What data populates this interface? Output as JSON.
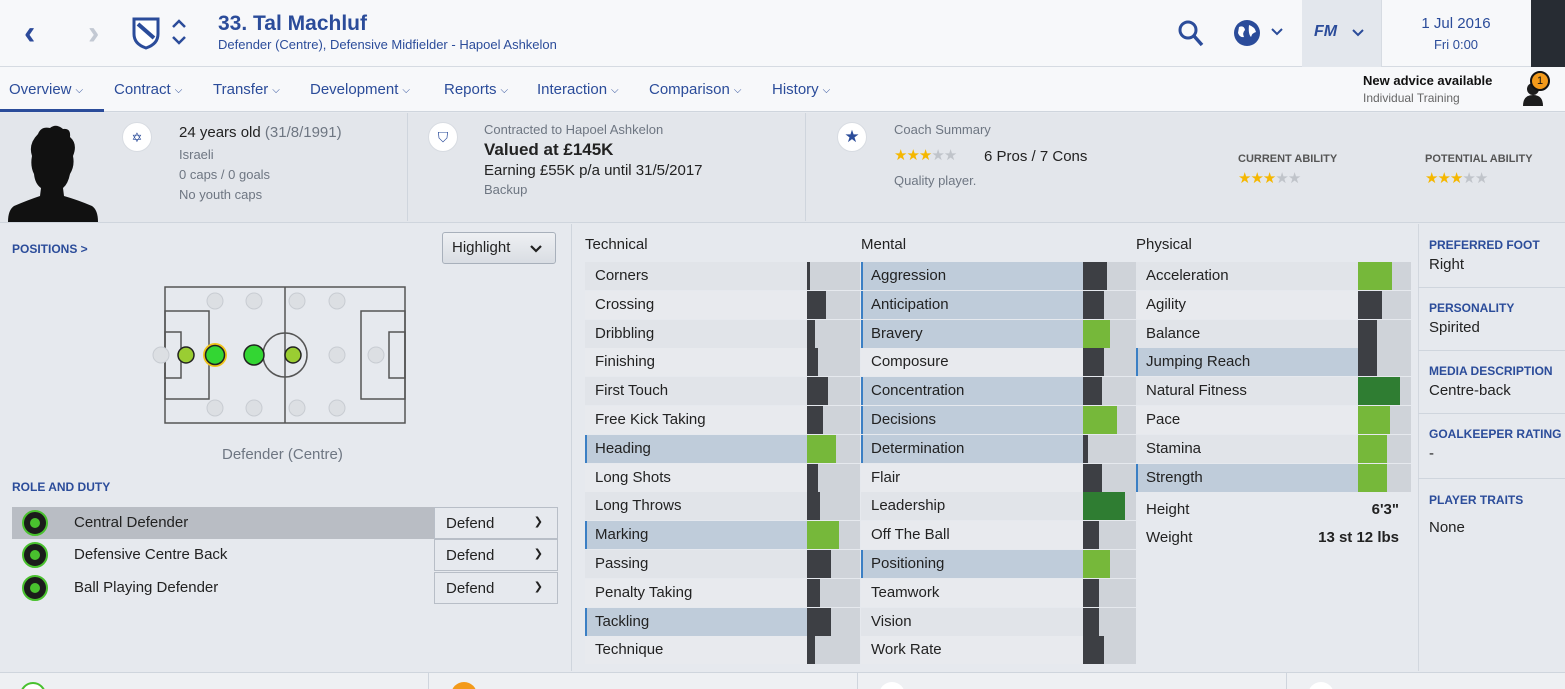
{
  "header": {
    "player_title": "33. Tal Machluf",
    "player_subtitle": "Defender (Centre), Defensive Midfielder - Hapoel Ashkelon",
    "back_glyph": "‹",
    "forward_glyph": "›",
    "fm_logo": "FM",
    "date": "1 Jul 2016",
    "time": "Fri 0:00",
    "icons": [
      "back-arrow-icon",
      "forward-arrow-icon",
      "club-badge-icon",
      "up-down-chevron-icon",
      "search-icon",
      "globe-icon",
      "fm-menu-icon"
    ]
  },
  "tabs": [
    {
      "label": "Overview"
    },
    {
      "label": "Contract"
    },
    {
      "label": "Transfer"
    },
    {
      "label": "Development"
    },
    {
      "label": "Reports"
    },
    {
      "label": "Interaction"
    },
    {
      "label": "Comparison"
    },
    {
      "label": "History"
    }
  ],
  "advice": {
    "title": "New advice available",
    "subtitle": "Individual Training",
    "count": "1"
  },
  "personal": {
    "age": "24 years old",
    "dob": "(31/8/1991)",
    "nationality": "Israeli",
    "caps": "0 caps / 0 goals",
    "youth_caps": "No youth caps",
    "flag_glyph": "✡"
  },
  "contract": {
    "club": "Contracted to Hapoel Ashkelon",
    "value": "Valued at £145K",
    "earning": "Earning £55K p/a until 31/5/2017",
    "status": "Backup",
    "badge_glyph": "⛉"
  },
  "coach": {
    "title": "Coach Summary",
    "rating": 3,
    "pros_cons": "6 Pros / 7 Cons",
    "quality": "Quality player.",
    "current_ability_label": "CURRENT ABILITY",
    "current_ability_stars": 3,
    "potential_ability_label": "POTENTIAL ABILITY",
    "potential_ability_stars": 3,
    "star_glyph": "★"
  },
  "positions": {
    "heading": "POSITIONS >",
    "highlight_label": "Highlight",
    "position_label": "Defender (Centre)"
  },
  "role_duty": {
    "heading": "ROLE AND DUTY",
    "roles": [
      {
        "name": "Central Defender",
        "duty": "Defend",
        "selected": true
      },
      {
        "name": "Defensive Centre Back",
        "duty": "Defend",
        "selected": false
      },
      {
        "name": "Ball Playing Defender",
        "duty": "Defend",
        "selected": false
      }
    ]
  },
  "attributes": {
    "technical_label": "Technical",
    "mental_label": "Mental",
    "physical_label": "Physical",
    "technical": [
      {
        "name": "Corners",
        "value": 1,
        "key": false
      },
      {
        "name": "Crossing",
        "value": 7,
        "key": false
      },
      {
        "name": "Dribbling",
        "value": 3,
        "key": false
      },
      {
        "name": "Finishing",
        "value": 4,
        "key": false
      },
      {
        "name": "First Touch",
        "value": 8,
        "key": false
      },
      {
        "name": "Free Kick Taking",
        "value": 6,
        "key": false
      },
      {
        "name": "Heading",
        "value": 11,
        "key": true
      },
      {
        "name": "Long Shots",
        "value": 4,
        "key": false
      },
      {
        "name": "Long Throws",
        "value": 5,
        "key": false
      },
      {
        "name": "Marking",
        "value": 12,
        "key": true
      },
      {
        "name": "Passing",
        "value": 9,
        "key": false
      },
      {
        "name": "Penalty Taking",
        "value": 5,
        "key": false
      },
      {
        "name": "Tackling",
        "value": 9,
        "key": true
      },
      {
        "name": "Technique",
        "value": 3,
        "key": false
      }
    ],
    "mental": [
      {
        "name": "Aggression",
        "value": 9,
        "key": true
      },
      {
        "name": "Anticipation",
        "value": 8,
        "key": true
      },
      {
        "name": "Bravery",
        "value": 10,
        "key": true
      },
      {
        "name": "Composure",
        "value": 8,
        "key": false
      },
      {
        "name": "Concentration",
        "value": 7,
        "key": true
      },
      {
        "name": "Decisions",
        "value": 13,
        "key": true
      },
      {
        "name": "Determination",
        "value": 2,
        "key": true
      },
      {
        "name": "Flair",
        "value": 7,
        "key": false
      },
      {
        "name": "Leadership",
        "value": 16,
        "key": false
      },
      {
        "name": "Off The Ball",
        "value": 6,
        "key": false
      },
      {
        "name": "Positioning",
        "value": 10,
        "key": true
      },
      {
        "name": "Teamwork",
        "value": 6,
        "key": false
      },
      {
        "name": "Vision",
        "value": 6,
        "key": false
      },
      {
        "name": "Work Rate",
        "value": 8,
        "key": false
      }
    ],
    "physical": [
      {
        "name": "Acceleration",
        "value": 13,
        "key": false
      },
      {
        "name": "Agility",
        "value": 9,
        "key": false
      },
      {
        "name": "Balance",
        "value": 7,
        "key": false
      },
      {
        "name": "Jumping Reach",
        "value": 7,
        "key": true
      },
      {
        "name": "Natural Fitness",
        "value": 16,
        "key": false
      },
      {
        "name": "Pace",
        "value": 12,
        "key": false
      },
      {
        "name": "Stamina",
        "value": 11,
        "key": false
      },
      {
        "name": "Strength",
        "value": 11,
        "key": true
      }
    ],
    "height_label": "Height",
    "height_value": "6'3\"",
    "weight_label": "Weight",
    "weight_value": "13 st 12 lbs"
  },
  "details": {
    "preferred_foot_label": "PREFERRED FOOT",
    "preferred_foot": "Right",
    "personality_label": "PERSONALITY",
    "personality": "Spirited",
    "media_label": "MEDIA DESCRIPTION",
    "media": "Centre-back",
    "gk_rating_label": "GOALKEEPER RATING",
    "gk_rating": "-",
    "traits_label": "PLAYER TRAITS",
    "traits": "None"
  },
  "colors": {
    "accent": "#2b4c9a",
    "bar_dark": "#3d3f44",
    "bar_green": "#76b83a",
    "bar_deepgreen": "#2f7d32",
    "key_row": "#bfccda",
    "badge": "#f39a1a"
  }
}
